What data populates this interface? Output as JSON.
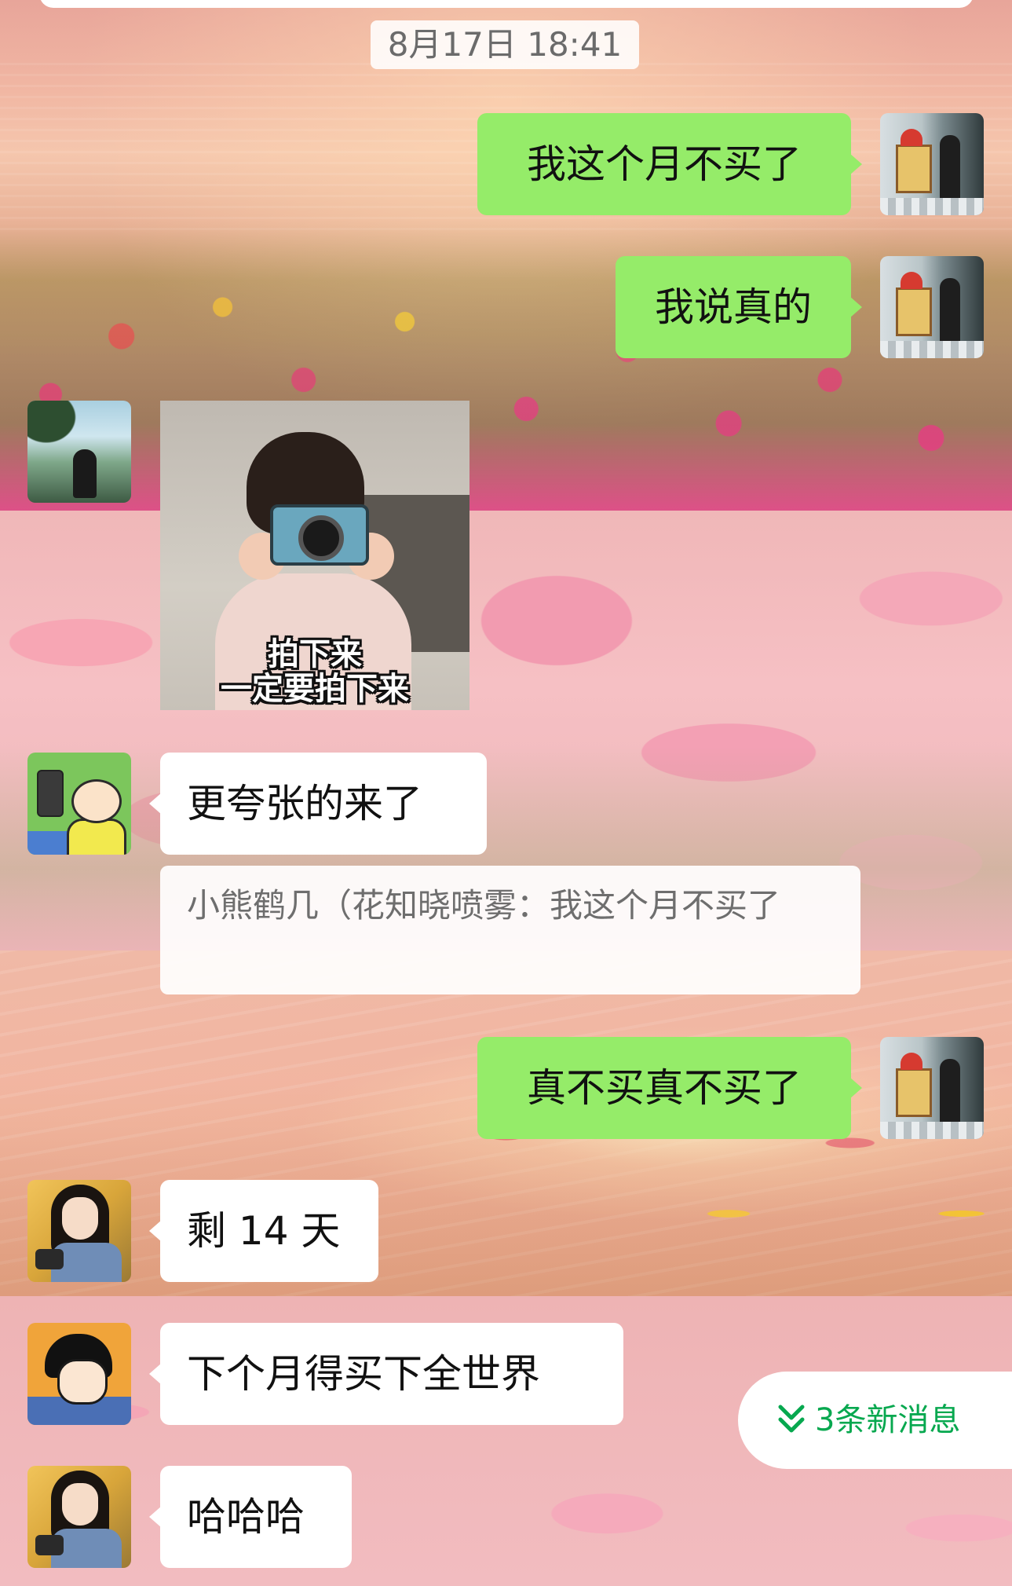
{
  "timestamp": "8月17日 18:41",
  "messages": [
    {
      "side": "right",
      "sender": "self",
      "type": "text",
      "text": "我这个月不买了"
    },
    {
      "side": "right",
      "sender": "self",
      "type": "text",
      "text": "我说真的"
    },
    {
      "side": "left",
      "sender": "member-lake",
      "type": "sticker",
      "caption_line1": "拍下来",
      "caption_line2": "一定要拍下来"
    },
    {
      "side": "left",
      "sender": "member-cartoon",
      "type": "text",
      "text": "更夸张的来了",
      "quote": "小熊鹤几（花知晓喷雾：我这个月不买了"
    },
    {
      "side": "right",
      "sender": "self",
      "type": "text",
      "text": "真不买真不买了"
    },
    {
      "side": "left",
      "sender": "member-girl",
      "type": "text",
      "text": "剩 14 天"
    },
    {
      "side": "left",
      "sender": "member-boy",
      "type": "text",
      "text": "下个月得买下全世界"
    },
    {
      "side": "left",
      "sender": "member-girl",
      "type": "text",
      "text": "哈哈哈"
    }
  ],
  "new_messages_pill": {
    "label": "3条新消息",
    "icon": "double-chevron-down-icon"
  },
  "colors": {
    "self_bubble": "#95ec69",
    "other_bubble": "#ffffff",
    "accent_green": "#07a84f"
  }
}
